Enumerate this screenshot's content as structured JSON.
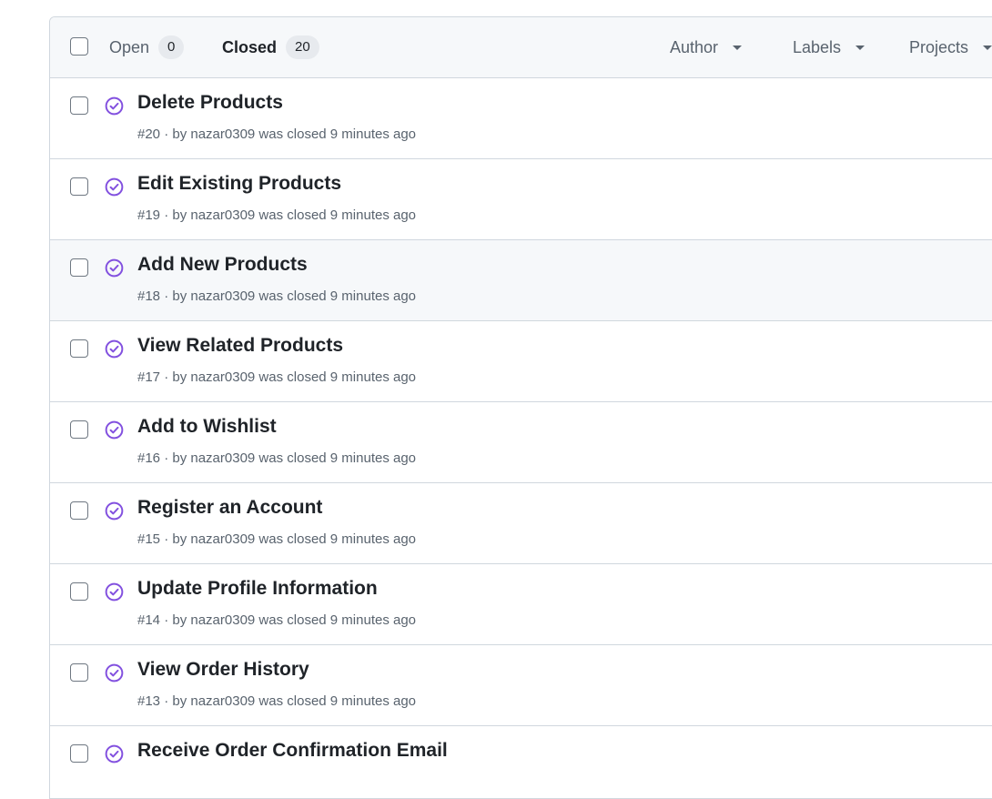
{
  "filters_bar": {
    "open_label": "Open",
    "open_count": "0",
    "closed_label": "Closed",
    "closed_count": "20",
    "author_label": "Author",
    "labels_label": "Labels",
    "projects_label": "Projects"
  },
  "colors": {
    "closed_icon": "#8250df",
    "border": "#d0d7de",
    "header_bg": "#f6f8fa",
    "muted_text": "#59636e"
  },
  "issues": [
    {
      "title": "Delete Products",
      "meta": "#20 · by nazar0309 was closed 9 minutes ago",
      "icon": "closed-check-icon"
    },
    {
      "title": "Edit Existing Products",
      "meta": "#19 · by nazar0309 was closed 9 minutes ago",
      "icon": "closed-check-icon"
    },
    {
      "title": "Add New Products",
      "meta": "#18 · by nazar0309 was closed 9 minutes ago",
      "icon": "closed-check-icon"
    },
    {
      "title": "View Related Products",
      "meta": "#17 · by nazar0309 was closed 9 minutes ago",
      "icon": "closed-check-icon"
    },
    {
      "title": "Add to Wishlist",
      "meta": "#16 · by nazar0309 was closed 9 minutes ago",
      "icon": "closed-check-icon"
    },
    {
      "title": "Register an Account",
      "meta": "#15 · by nazar0309 was closed 9 minutes ago",
      "icon": "closed-check-icon"
    },
    {
      "title": "Update Profile Information",
      "meta": "#14 · by nazar0309 was closed 9 minutes ago",
      "icon": "closed-check-icon"
    },
    {
      "title": "View Order History",
      "meta": "#13 · by nazar0309 was closed 9 minutes ago",
      "icon": "closed-check-icon"
    },
    {
      "title": "Receive Order Confirmation Email",
      "meta": "",
      "icon": "closed-check-icon"
    }
  ]
}
